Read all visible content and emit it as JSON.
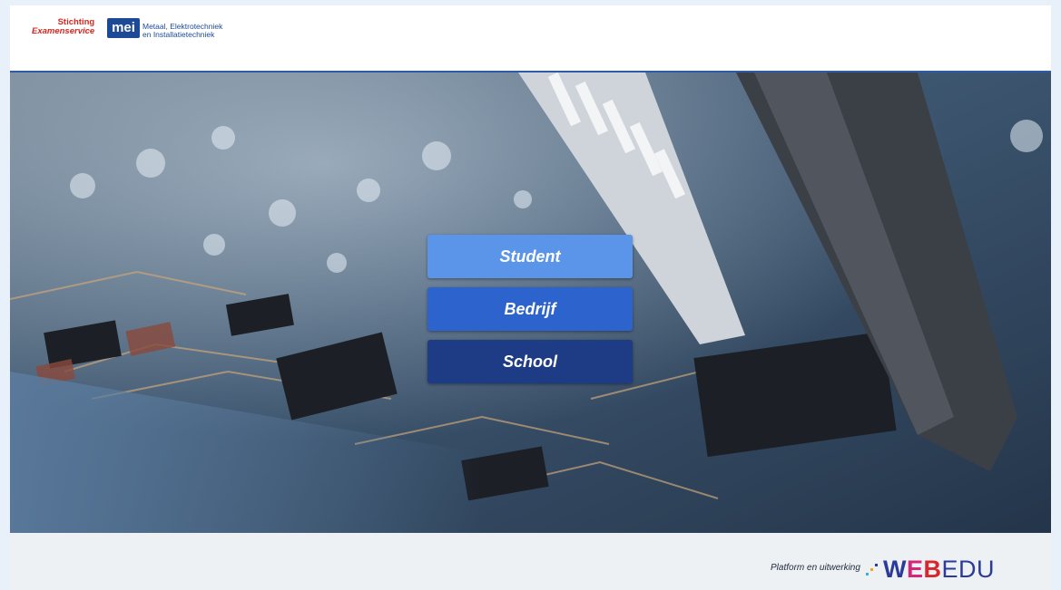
{
  "header": {
    "org_line1": "Stichting",
    "org_line2": "Examenservice",
    "badge": "mei",
    "tagline_line1": "Metaal, Elektrotechniek",
    "tagline_line2": "en Installatietechniek"
  },
  "menu": {
    "student": "Student",
    "bedrijf": "Bedrijf",
    "school": "School"
  },
  "footer": {
    "platform_text": "Platform en uitwerking",
    "brand_w": "W",
    "brand_e": "E",
    "brand_b": "B",
    "brand_edu": "EDU"
  },
  "colors": {
    "background": "#e8f1fa",
    "accent_blue": "#2f5aa6",
    "btn_student": "#5b95ea",
    "btn_bedrijf": "#2d63cc",
    "btn_school": "#1e3c86"
  },
  "icons": {
    "hero": "circuit-board-photo",
    "logo_dots": "webedu-dots-icon"
  }
}
